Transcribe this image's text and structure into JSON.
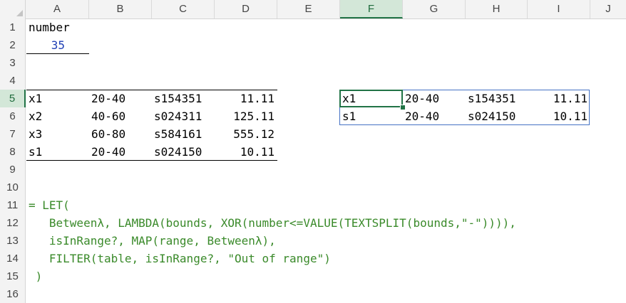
{
  "columns": [
    "A",
    "B",
    "C",
    "D",
    "E",
    "F",
    "G",
    "H",
    "I",
    "J"
  ],
  "rows": [
    "1",
    "2",
    "3",
    "4",
    "5",
    "6",
    "7",
    "8",
    "9",
    "10",
    "11",
    "12",
    "13",
    "14",
    "15",
    "16"
  ],
  "active_column": "F",
  "active_row": "5",
  "cells": {
    "a1": "number",
    "a2": "35",
    "source_table": [
      [
        "x1",
        "20-40",
        "s154351",
        "11.11"
      ],
      [
        "x2",
        "40-60",
        "s024311",
        "125.11"
      ],
      [
        "x3",
        "60-80",
        "s584161",
        "555.12"
      ],
      [
        "s1",
        "20-40",
        "s024150",
        "10.11"
      ]
    ],
    "result_table": [
      [
        "x1",
        "20-40",
        "s154351",
        "11.11"
      ],
      [
        "s1",
        "20-40",
        "s024150",
        "10.11"
      ]
    ]
  },
  "formula_lines": [
    "= LET(",
    "   Betweenλ, LAMBDA(bounds, XOR(number<=VALUE(TEXTSPLIT(bounds,\"-\")))),",
    "   isInRange?, MAP(range, Betweenλ),",
    "   FILTER(table, isInRange?, \"Out of range\")",
    " )"
  ],
  "colors": {
    "accent": "#217346",
    "spill_border": "#4472c4",
    "formula_text": "#3a8a2a",
    "value_text": "#1f3fb5"
  }
}
